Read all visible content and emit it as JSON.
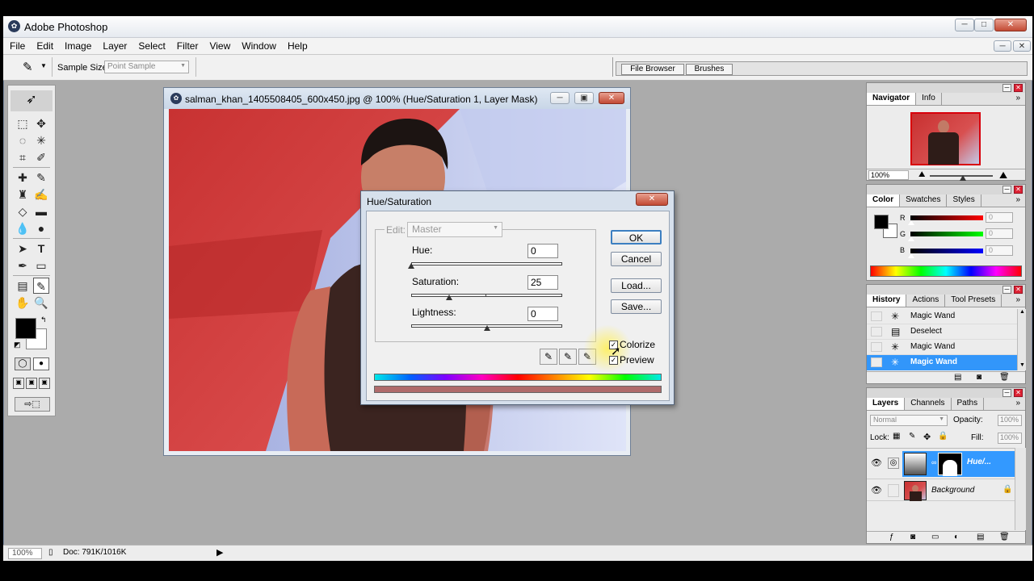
{
  "app": {
    "title": "Adobe Photoshop"
  },
  "menu": [
    "File",
    "Edit",
    "Image",
    "Layer",
    "Select",
    "Filter",
    "View",
    "Window",
    "Help"
  ],
  "options": {
    "sample_size_label": "Sample Size:",
    "sample_size_value": "Point Sample",
    "well_tabs": [
      "File Browser",
      "Brushes"
    ]
  },
  "document": {
    "title": "salman_khan_1405508405_600x450.jpg @ 100% (Hue/Saturation 1, Layer Mask)"
  },
  "dialog": {
    "title": "Hue/Saturation",
    "edit_label": "Edit:",
    "edit_value": "Master",
    "hue_label": "Hue:",
    "hue_value": "0",
    "hue_level": 0,
    "saturation_label": "Saturation:",
    "saturation_value": "25",
    "saturation_level": 25,
    "lightness_label": "Lightness:",
    "lightness_value": "0",
    "lightness_level": 0,
    "ok": "OK",
    "cancel": "Cancel",
    "load": "Load...",
    "save": "Save...",
    "colorize": "Colorize",
    "colorize_checked": true,
    "preview": "Preview",
    "preview_checked": true
  },
  "navigator": {
    "tabs": [
      "Navigator",
      "Info"
    ],
    "zoom": "100%"
  },
  "color": {
    "tabs": [
      "Color",
      "Swatches",
      "Styles"
    ],
    "r_label": "R",
    "r_value": "0",
    "g_label": "G",
    "g_value": "0",
    "b_label": "B",
    "b_value": "0"
  },
  "history": {
    "tabs": [
      "History",
      "Actions",
      "Tool Presets"
    ],
    "items": [
      "Magic Wand",
      "Deselect",
      "Magic Wand",
      "Magic Wand"
    ],
    "selected_index": 3
  },
  "layers": {
    "tabs": [
      "Layers",
      "Channels",
      "Paths"
    ],
    "blend_mode": "Normal",
    "opacity_label": "Opacity:",
    "opacity_value": "100%",
    "lock_label": "Lock:",
    "fill_label": "Fill:",
    "fill_value": "100%",
    "rows": [
      "Hue/...",
      "Background"
    ]
  },
  "status": {
    "zoom": "100%",
    "doc": "Doc: 791K/1016K"
  },
  "colors": {
    "accent": "#3399ff",
    "selection": "#3296fa"
  }
}
